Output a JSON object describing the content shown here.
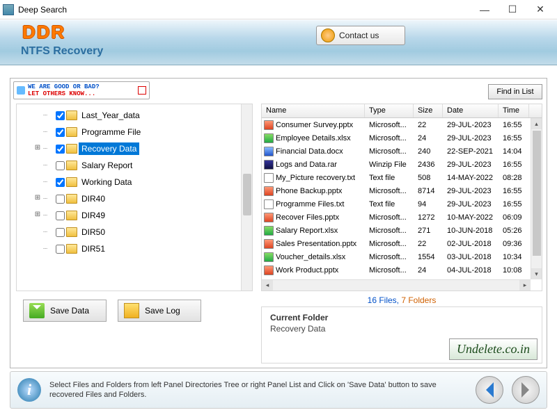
{
  "window": {
    "title": "Deep Search"
  },
  "header": {
    "logo": "DDR",
    "subtitle": "NTFS Recovery",
    "contact": "Contact us"
  },
  "feedback": {
    "line1": "WE ARE GOOD OR BAD?",
    "line2": "LET OTHERS KNOW..."
  },
  "buttons": {
    "find": "Find in List",
    "save_data": "Save Data",
    "save_log": "Save Log"
  },
  "tree": [
    {
      "label": "Last_Year_data",
      "checked": true,
      "expandable": false
    },
    {
      "label": "Programme File",
      "checked": true,
      "expandable": false
    },
    {
      "label": "Recovery Data",
      "checked": true,
      "expandable": true,
      "selected": true
    },
    {
      "label": "Salary Report",
      "checked": false,
      "expandable": false
    },
    {
      "label": "Working Data",
      "checked": true,
      "expandable": false
    },
    {
      "label": "DIR40",
      "checked": false,
      "expandable": true
    },
    {
      "label": "DIR49",
      "checked": false,
      "expandable": true
    },
    {
      "label": "DIR50",
      "checked": false,
      "expandable": false
    },
    {
      "label": "DIR51",
      "checked": false,
      "expandable": false
    }
  ],
  "list": {
    "cols": {
      "name": "Name",
      "type": "Type",
      "size": "Size",
      "date": "Date",
      "time": "Time"
    },
    "rows": [
      {
        "icon": "pptx",
        "name": "Consumer Survey.pptx",
        "type": "Microsoft...",
        "size": "22",
        "date": "29-JUL-2023",
        "time": "16:55"
      },
      {
        "icon": "xlsx",
        "name": "Employee Details.xlsx",
        "type": "Microsoft...",
        "size": "24",
        "date": "29-JUL-2023",
        "time": "16:55"
      },
      {
        "icon": "docx",
        "name": "Financial Data.docx",
        "type": "Microsoft...",
        "size": "240",
        "date": "22-SEP-2021",
        "time": "14:04"
      },
      {
        "icon": "rar",
        "name": "Logs and Data.rar",
        "type": "Winzip File",
        "size": "2436",
        "date": "29-JUL-2023",
        "time": "16:55"
      },
      {
        "icon": "txt",
        "name": "My_Picture recovery.txt",
        "type": "Text file",
        "size": "508",
        "date": "14-MAY-2022",
        "time": "08:28"
      },
      {
        "icon": "pptx",
        "name": "Phone Backup.pptx",
        "type": "Microsoft...",
        "size": "8714",
        "date": "29-JUL-2023",
        "time": "16:55"
      },
      {
        "icon": "txt",
        "name": "Programme Files.txt",
        "type": "Text file",
        "size": "94",
        "date": "29-JUL-2023",
        "time": "16:55"
      },
      {
        "icon": "pptx",
        "name": "Recover Files.pptx",
        "type": "Microsoft...",
        "size": "1272",
        "date": "10-MAY-2022",
        "time": "06:09"
      },
      {
        "icon": "xlsx",
        "name": "Salary Report.xlsx",
        "type": "Microsoft...",
        "size": "271",
        "date": "10-JUN-2018",
        "time": "05:26"
      },
      {
        "icon": "pptx",
        "name": "Sales Presentation.pptx",
        "type": "Microsoft...",
        "size": "22",
        "date": "02-JUL-2018",
        "time": "09:36"
      },
      {
        "icon": "xlsx",
        "name": "Voucher_details.xlsx",
        "type": "Microsoft...",
        "size": "1554",
        "date": "03-JUL-2018",
        "time": "10:34"
      },
      {
        "icon": "pptx",
        "name": "Work Product.pptx",
        "type": "Microsoft...",
        "size": "24",
        "date": "04-JUL-2018",
        "time": "10:08"
      }
    ]
  },
  "status": {
    "files": "16 Files,",
    "folders": " 7 Folders"
  },
  "current": {
    "label": "Current Folder",
    "value": "Recovery Data"
  },
  "watermark": "Undelete.co.in",
  "footer": {
    "text": "Select Files and Folders from left Panel Directories Tree or right Panel List and Click on 'Save Data' button to save recovered Files and Folders."
  }
}
